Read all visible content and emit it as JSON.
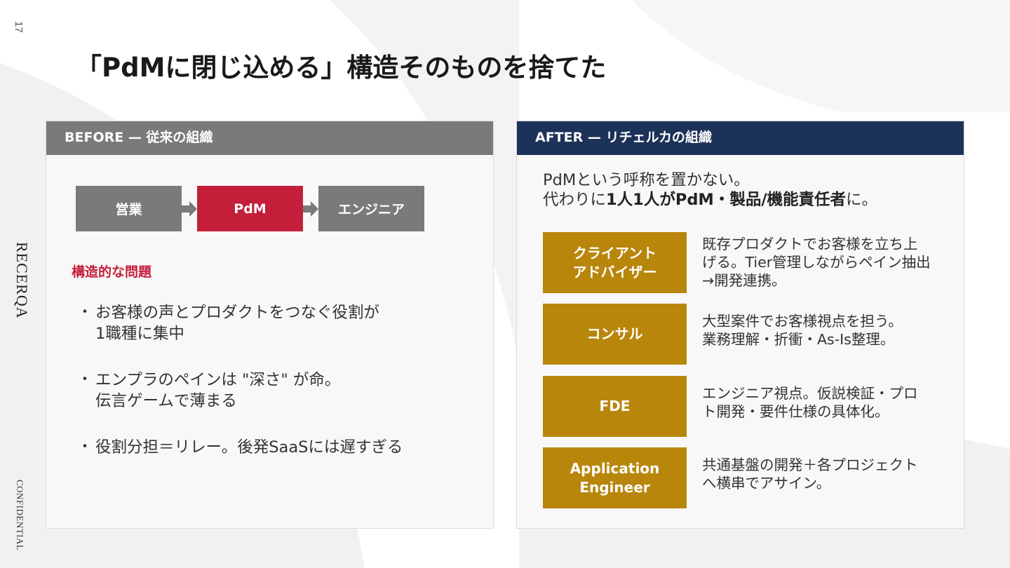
{
  "page_number": "17",
  "brand": "RECERQA",
  "confidential": "CONFIDENTIAL",
  "title": "「PdMに閉じ込める」構造そのものを捨てた",
  "colors": {
    "before_header": "#7a7a7a",
    "after_header": "#1c3258",
    "pdm_red": "#c41e3a",
    "role_gold": "#b8860b"
  },
  "before": {
    "header": "BEFORE — 従来の組織",
    "flow": [
      "営業",
      "PdM",
      "エンジニア"
    ],
    "flow_arrow_icon": "arrow-right-icon",
    "problem_heading": "構造的な問題",
    "bullets": [
      {
        "lines": [
          "お客様の声とプロダクトをつなぐ役割が",
          "1職種に集中"
        ]
      },
      {
        "lines": [
          "エンプラのペインは \"深さ\" が命。",
          "伝言ゲームで薄まる"
        ]
      },
      {
        "lines": [
          "役割分担＝リレー。後発SaaSには遅すぎる"
        ]
      }
    ]
  },
  "after": {
    "header": "AFTER — リチェルカの組織",
    "intro_line1": "PdMという呼称を置かない。",
    "intro_line2_prefix": "代わりに",
    "intro_line2_bold": "1人1人がPdM・製品/機能責任者",
    "intro_line2_suffix": "に。",
    "roles": [
      {
        "name_lines": [
          "クライアント",
          "アドバイザー"
        ],
        "desc_lines": [
          "既存プロダクトでお客様を立ち上",
          "げる。Tier管理しながらペイン抽出",
          "→開発連携。"
        ]
      },
      {
        "name_lines": [
          "コンサル"
        ],
        "desc_lines": [
          "大型案件でお客様視点を担う。",
          "業務理解・折衝・As-Is整理。"
        ]
      },
      {
        "name_lines": [
          "FDE"
        ],
        "desc_lines": [
          "エンジニア視点。仮説検証・プロ",
          "ト開発・要件仕様の具体化。"
        ]
      },
      {
        "name_lines": [
          "Application",
          "Engineer"
        ],
        "desc_lines": [
          "共通基盤の開発＋各プロジェクト",
          "へ横串でアサイン。"
        ]
      }
    ]
  }
}
